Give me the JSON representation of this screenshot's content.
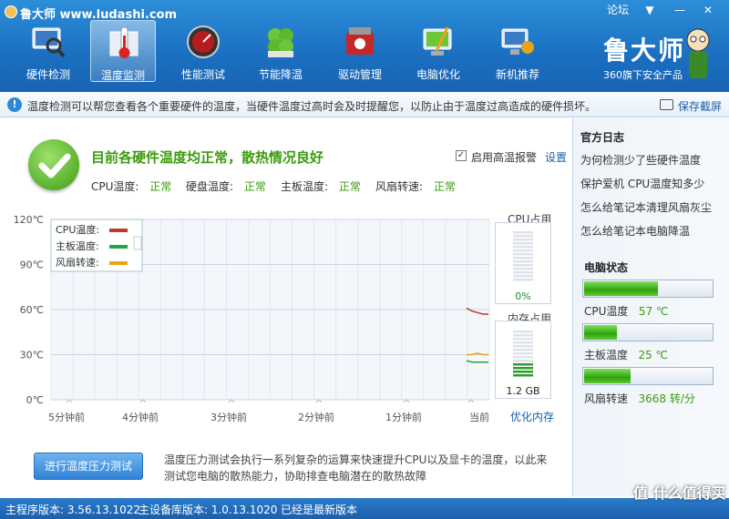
{
  "app": {
    "title": "鲁大师 www.ludashi.com",
    "forum": "论坛"
  },
  "toolbar": [
    {
      "label": "硬件检测",
      "icon": "monitor-magnifier-icon"
    },
    {
      "label": "温度监测",
      "icon": "thermometer-icon"
    },
    {
      "label": "性能测试",
      "icon": "speedometer-icon"
    },
    {
      "label": "节能降温",
      "icon": "clover-icon"
    },
    {
      "label": "驱动管理",
      "icon": "driver-box-icon"
    },
    {
      "label": "电脑优化",
      "icon": "broom-monitor-icon"
    },
    {
      "label": "新机推荐",
      "icon": "new-pc-icon"
    }
  ],
  "brand": {
    "name": "鲁大师",
    "sub": "360旗下安全产品"
  },
  "info": {
    "message": "温度检测可以帮您查看各个重要硬件的温度，当硬件温度过高时会及时提醒您，以防止由于温度过高造成的硬件损坏。",
    "screenshot": "保存截屏"
  },
  "status": {
    "title": "目前各硬件温度均正常，散热情况良好",
    "alarm": "启用高温报警",
    "alarm_checked": "✓",
    "settings": "设置",
    "items": [
      {
        "label": "CPU温度:",
        "value": "正常"
      },
      {
        "label": "硬盘温度:",
        "value": "正常"
      },
      {
        "label": "主板温度:",
        "value": "正常"
      },
      {
        "label": "风扇转速:",
        "value": "正常"
      }
    ]
  },
  "chart_data": {
    "type": "line",
    "y_ticks": [
      "0℃",
      "30℃",
      "60℃",
      "90℃",
      "120℃"
    ],
    "ylim": [
      0,
      120
    ],
    "x_ticks": [
      "5分钟前",
      "4分钟前",
      "3分钟前",
      "2分钟前",
      "1分钟前",
      "当前"
    ],
    "grid": true,
    "legend": "top-left",
    "series": [
      {
        "name": "CPU温度:",
        "color": "#c0392b",
        "values": [
          61,
          59,
          58,
          57,
          57
        ]
      },
      {
        "name": "主板温度:",
        "color": "#27a344",
        "values": [
          26,
          25,
          25,
          25,
          25
        ]
      },
      {
        "name": "风扇转速:",
        "color": "#e6a614",
        "values": [
          30,
          30,
          31,
          30,
          30
        ]
      }
    ]
  },
  "cpu_usage": {
    "title": "CPU占用",
    "value": "0%",
    "fraction": 0.0
  },
  "mem_usage": {
    "title": "内存占用",
    "value": "1.2 GB",
    "fraction": 0.28
  },
  "optimize": "优化内存",
  "stress": {
    "button": "进行温度压力测试",
    "desc": "温度压力测试会执行一系列复杂的运算来快速提升CPU以及显卡的温度，以此来测试您电脑的散热能力，协助排查电脑潜在的散热故障"
  },
  "sidebar": {
    "log_title": "官方日志",
    "links": [
      "为何检测少了些硬件温度",
      "保护爱机 CPU温度知多少",
      "怎么给笔记本清理风扇灰尘",
      "怎么给笔记本电脑降温"
    ],
    "state_title": "电脑状态",
    "meters": [
      {
        "label": "CPU温度",
        "value": "57 ℃",
        "fraction": 0.57
      },
      {
        "label": "主板温度",
        "value": "25 ℃",
        "fraction": 0.25
      },
      {
        "label": "风扇转速",
        "value": "3668 转/分",
        "fraction": 0.36
      }
    ]
  },
  "statusbar": {
    "main_version": "主程序版本: 3.56.13.1022",
    "db_version": "主设备库版本: 1.0.13.1020",
    "latest": "已经是最新版本"
  },
  "watermark": "值 什么值得买"
}
